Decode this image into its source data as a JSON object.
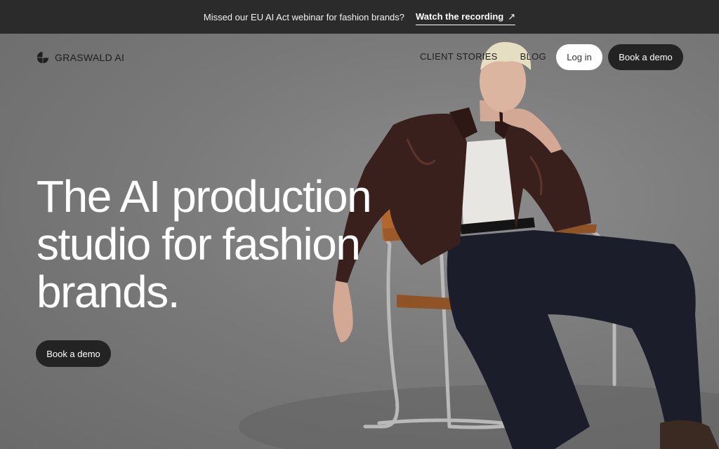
{
  "announcement": {
    "text": "Missed our EU AI Act webinar for fashion brands?",
    "link_label": "Watch the recording",
    "link_icon": "arrow-up-right-icon"
  },
  "header": {
    "brand": "GRASWALD AI",
    "nav": [
      "CLIENT STORIES",
      "BLOG"
    ],
    "login_label": "Log in",
    "demo_label": "Book a demo"
  },
  "hero": {
    "headline_lines": [
      "The AI production",
      "studio for fashion",
      "brands."
    ],
    "cta_label": "Book a demo"
  },
  "colors": {
    "announce_bg": "#2b2b2b",
    "dark_button": "#232323",
    "light_button": "#ffffff",
    "background": "#7a7a7a"
  }
}
